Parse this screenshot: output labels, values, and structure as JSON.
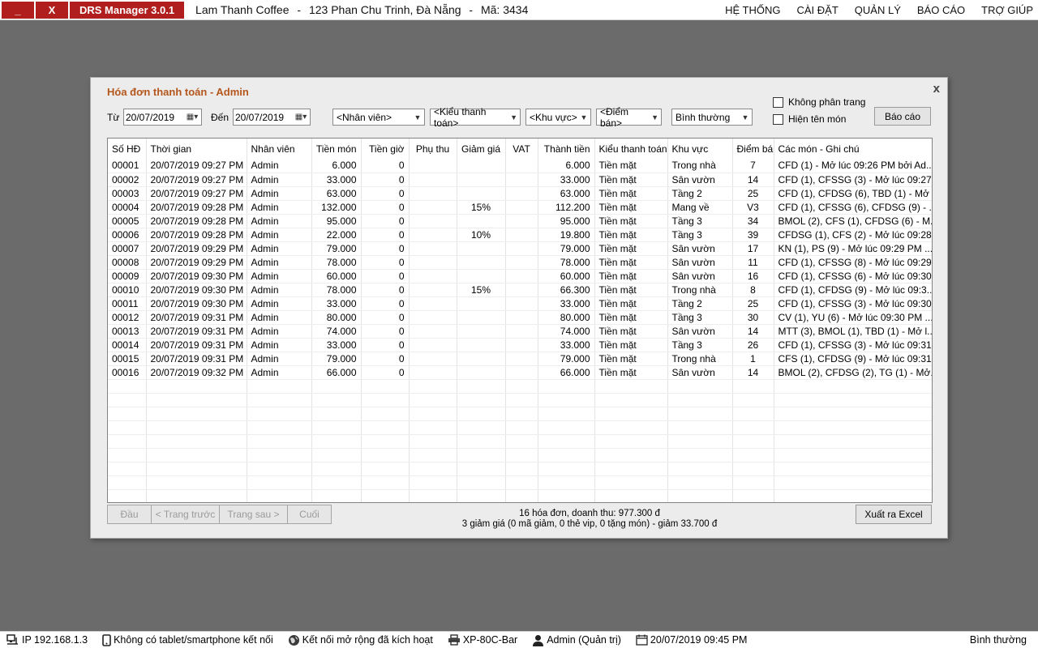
{
  "topbar": {
    "minimize": "_",
    "close": "X",
    "app_title": "DRS Manager 3.0.1",
    "store_name": "Lam Thanh Coffee",
    "sep1": "-",
    "address": "123 Phan Chu Trinh, Đà Nẵng",
    "sep2": "-",
    "code": "Mã: 3434",
    "menu": [
      "HỆ THỐNG",
      "CÀI ĐẶT",
      "QUẢN LÝ",
      "BÁO CÁO",
      "TRỢ GIÚP"
    ]
  },
  "dialog": {
    "title": "Hóa đơn thanh toán - Admin",
    "close": "x",
    "from_label": "Từ",
    "from_date": "20/07/2019",
    "to_label": "Đến",
    "to_date": "20/07/2019",
    "filters": {
      "employee": "<Nhân viên>",
      "payment_type": "<Kiểu thanh toán>",
      "area": "<Khu vực>",
      "point": "<Điểm bán>",
      "mode": "Bình thường"
    },
    "checkbox_no_paging": "Không phân trang",
    "checkbox_show_items": "Hiện tên món",
    "report_button": "Báo cáo",
    "columns": [
      "Số HĐ",
      "Thời gian",
      "Nhân viên",
      "Tiền món",
      "Tiền giờ",
      "Phụ thu",
      "Giảm giá",
      "VAT",
      "Thành tiền",
      "Kiểu thanh toán",
      "Khu vực",
      "Điểm bán",
      "Các món - Ghi chú"
    ],
    "rows": [
      [
        "00001",
        "20/07/2019 09:27 PM",
        "Admin",
        "6.000",
        "0",
        "",
        "",
        "",
        "6.000",
        "Tiền mặt",
        "Trong nhà",
        "7",
        "CFD (1) - Mở lúc 09:26 PM bởi Ad..."
      ],
      [
        "00002",
        "20/07/2019 09:27 PM",
        "Admin",
        "33.000",
        "0",
        "",
        "",
        "",
        "33.000",
        "Tiền mặt",
        "Sân vườn",
        "14",
        "CFD (1), CFSSG (3) - Mở lúc 09:27..."
      ],
      [
        "00003",
        "20/07/2019 09:27 PM",
        "Admin",
        "63.000",
        "0",
        "",
        "",
        "",
        "63.000",
        "Tiền mặt",
        "Tầng 2",
        "25",
        "CFD (1), CFDSG (6), TBD (1) - Mở ..."
      ],
      [
        "00004",
        "20/07/2019 09:28 PM",
        "Admin",
        "132.000",
        "0",
        "",
        "15%",
        "",
        "112.200",
        "Tiền mặt",
        "Mang về",
        "V3",
        "CFD (1), CFSSG (6), CFDSG (9) - ..."
      ],
      [
        "00005",
        "20/07/2019 09:28 PM",
        "Admin",
        "95.000",
        "0",
        "",
        "",
        "",
        "95.000",
        "Tiền mặt",
        "Tầng 3",
        "34",
        "BMOL (2), CFS (1), CFDSG (6) - M..."
      ],
      [
        "00006",
        "20/07/2019 09:28 PM",
        "Admin",
        "22.000",
        "0",
        "",
        "10%",
        "",
        "19.800",
        "Tiền mặt",
        "Tầng 3",
        "39",
        "CFDSG (1), CFS (2) - Mở lúc 09:28..."
      ],
      [
        "00007",
        "20/07/2019 09:29 PM",
        "Admin",
        "79.000",
        "0",
        "",
        "",
        "",
        "79.000",
        "Tiền mặt",
        "Sân vườn",
        "17",
        "KN (1), PS (9) - Mở lúc 09:29 PM ..."
      ],
      [
        "00008",
        "20/07/2019 09:29 PM",
        "Admin",
        "78.000",
        "0",
        "",
        "",
        "",
        "78.000",
        "Tiền mặt",
        "Sân vườn",
        "11",
        "CFD (1), CFSSG (8) - Mở lúc 09:29..."
      ],
      [
        "00009",
        "20/07/2019 09:30 PM",
        "Admin",
        "60.000",
        "0",
        "",
        "",
        "",
        "60.000",
        "Tiền mặt",
        "Sân vườn",
        "16",
        "CFD (1), CFSSG (6) - Mở lúc 09:30..."
      ],
      [
        "00010",
        "20/07/2019 09:30 PM",
        "Admin",
        "78.000",
        "0",
        "",
        "15%",
        "",
        "66.300",
        "Tiền mặt",
        "Trong nhà",
        "8",
        "CFD (1), CFDSG (9) - Mở lúc 09:3..."
      ],
      [
        "00011",
        "20/07/2019 09:30 PM",
        "Admin",
        "33.000",
        "0",
        "",
        "",
        "",
        "33.000",
        "Tiền mặt",
        "Tầng 2",
        "25",
        "CFD (1), CFSSG (3) - Mở lúc 09:30..."
      ],
      [
        "00012",
        "20/07/2019 09:31 PM",
        "Admin",
        "80.000",
        "0",
        "",
        "",
        "",
        "80.000",
        "Tiền mặt",
        "Tầng 3",
        "30",
        "CV (1), YU (6) - Mở lúc 09:30 PM ..."
      ],
      [
        "00013",
        "20/07/2019 09:31 PM",
        "Admin",
        "74.000",
        "0",
        "",
        "",
        "",
        "74.000",
        "Tiền mặt",
        "Sân vườn",
        "14",
        "MTT (3), BMOL (1), TBD (1) - Mở l..."
      ],
      [
        "00014",
        "20/07/2019 09:31 PM",
        "Admin",
        "33.000",
        "0",
        "",
        "",
        "",
        "33.000",
        "Tiền mặt",
        "Tầng 3",
        "26",
        "CFD (1), CFSSG (3) - Mở lúc 09:31..."
      ],
      [
        "00015",
        "20/07/2019 09:31 PM",
        "Admin",
        "79.000",
        "0",
        "",
        "",
        "",
        "79.000",
        "Tiền mặt",
        "Trong nhà",
        "1",
        "CFS (1), CFDSG (9) - Mở lúc 09:31..."
      ],
      [
        "00016",
        "20/07/2019 09:32 PM",
        "Admin",
        "66.000",
        "0",
        "",
        "",
        "",
        "66.000",
        "Tiền mặt",
        "Sân vườn",
        "14",
        "BMOL (2), CFDSG (2), TG (1) - Mở..."
      ]
    ],
    "pager": {
      "first": "Đầu",
      "prev": "< Trang trước",
      "next": "Trang sau >",
      "last": "Cuối"
    },
    "summary_line1": "16 hóa đơn, doanh thu: 977.300 đ",
    "summary_line2": "3 giảm giá (0 mã giảm, 0 thẻ vip, 0 tặng món) - giảm 33.700 đ",
    "export_button": "Xuất ra Excel"
  },
  "statusbar": {
    "ip": "IP 192.168.1.3",
    "tablet": "Không có tablet/smartphone kết nối",
    "extension": "Kết nối mở rộng đã kích hoạt",
    "printer": "XP-80C-Bar",
    "user": "Admin (Quản trị)",
    "datetime": "20/07/2019 09:45 PM",
    "mode": "Bình thường"
  },
  "colors": {
    "accent_red": "#b01e1e",
    "title_orange": "#b5561c",
    "desktop_gray": "#6b6b6b"
  },
  "icons": [
    "network-icon",
    "phone-icon",
    "globe-icon",
    "printer-icon",
    "user-icon",
    "calendar-icon"
  ]
}
